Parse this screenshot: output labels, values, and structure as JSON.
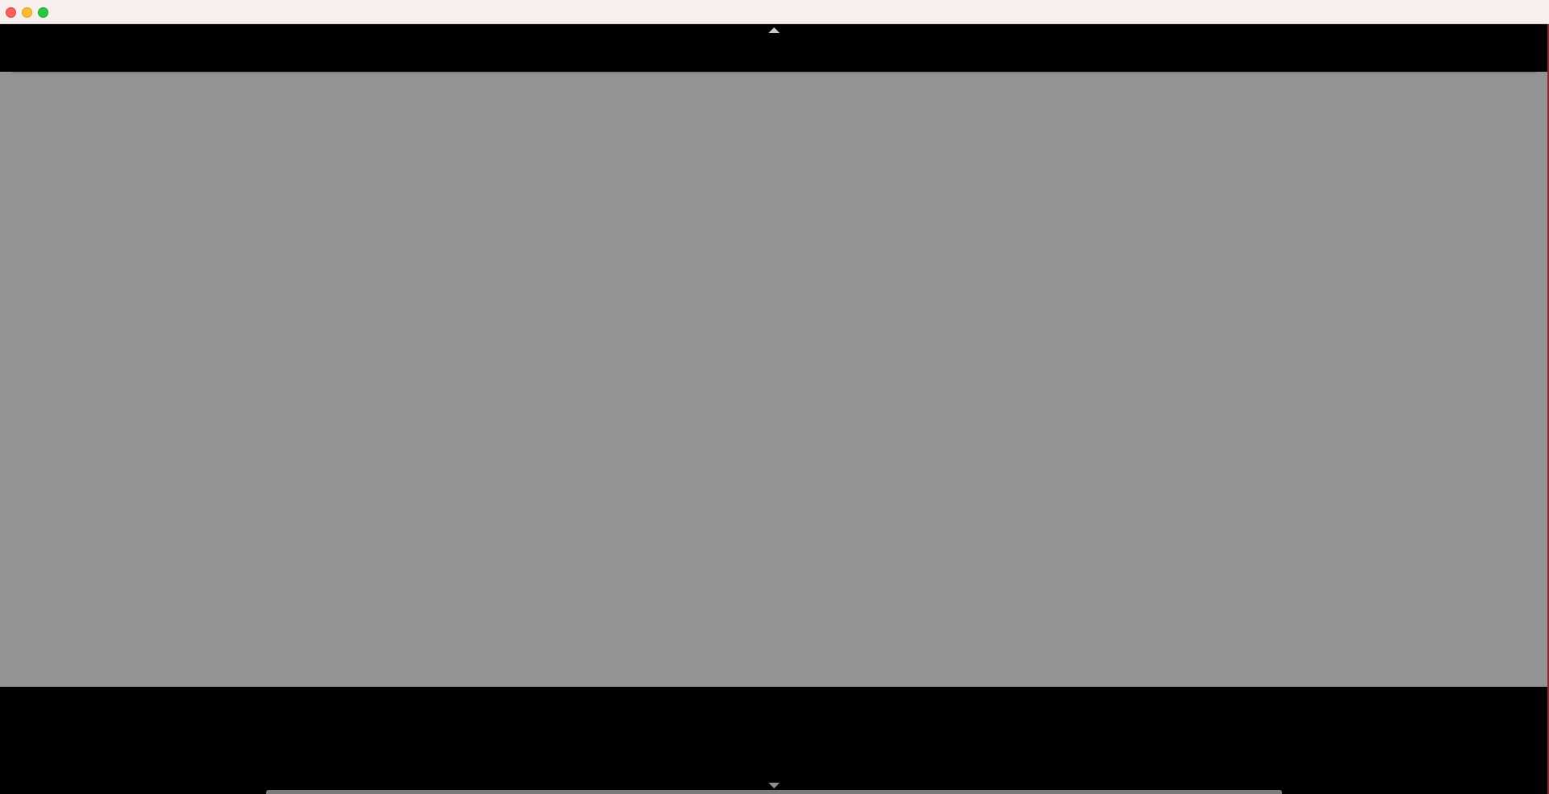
{
  "window": {
    "controls": {
      "close_icon": "close-icon",
      "minimize_icon": "minimize-icon",
      "maximize_icon": "maximize-icon",
      "close_color": "#fe5f57",
      "minimize_color": "#febc2e",
      "maximize_color": "#28c840"
    }
  },
  "viewport": {
    "background": "#939393",
    "frame_color": "#000000",
    "scroll_up_icon": "chevron-up-icon",
    "scroll_down_icon": "chevron-down-icon"
  }
}
